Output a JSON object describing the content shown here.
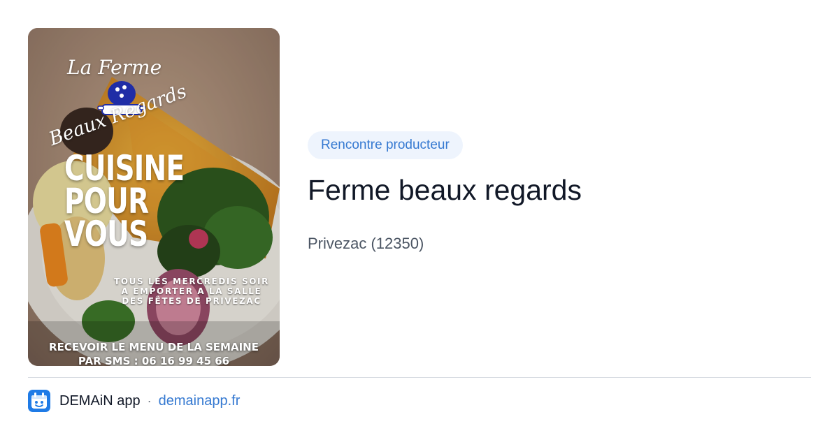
{
  "poster": {
    "brand_line1": "La Ferme",
    "brand_line2": "Beaux Regards",
    "headline": [
      "CUISINE",
      "POUR",
      "VOUS"
    ],
    "schedule": [
      "TOUS LES MERCREDIS SOIR",
      "A EMPORTER A LA SALLE",
      "DES FÊTES DE PRIVEZAC"
    ],
    "cta": [
      "RECEVOIR LE MENU DE LA SEMAINE",
      "PAR SMS : 06 16 99 45 66"
    ]
  },
  "card": {
    "tag": "Rencontre producteur",
    "title": "Ferme beaux regards",
    "location": "Privezac (12350)"
  },
  "footer": {
    "app_name": "DEMAiN app",
    "separator": "·",
    "domain": "demainapp.fr",
    "app_icon": "demain-app-icon"
  },
  "colors": {
    "tag_bg": "#eef4fd",
    "accent": "#3579d1",
    "title": "#111827",
    "muted": "#4b5563",
    "divider": "#d9dde3",
    "app_icon_bg": "#1f7be6"
  }
}
